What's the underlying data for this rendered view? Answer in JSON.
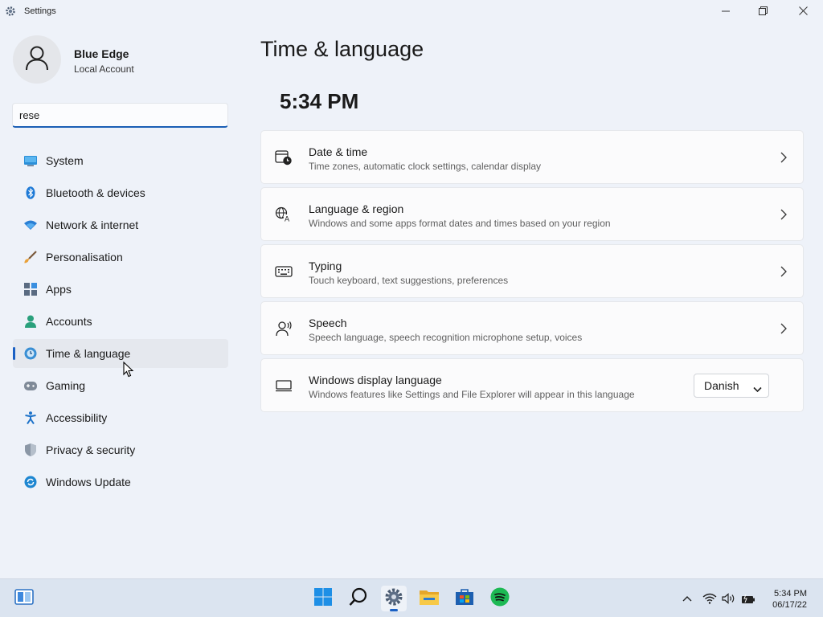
{
  "window": {
    "title": "Settings",
    "controls": {
      "minimize": "minimize-icon",
      "maximize": "restore-icon",
      "close": "close-icon"
    }
  },
  "profile": {
    "name": "Blue Edge",
    "account_type": "Local Account"
  },
  "search": {
    "value": "rese",
    "placeholder": ""
  },
  "sidebar": {
    "items": [
      {
        "label": "System",
        "icon": "system-icon",
        "active": false
      },
      {
        "label": "Bluetooth & devices",
        "icon": "bluetooth-icon",
        "active": false
      },
      {
        "label": "Network & internet",
        "icon": "wifi-icon",
        "active": false
      },
      {
        "label": "Personalisation",
        "icon": "brush-icon",
        "active": false
      },
      {
        "label": "Apps",
        "icon": "apps-icon",
        "active": false
      },
      {
        "label": "Accounts",
        "icon": "person-icon",
        "active": false
      },
      {
        "label": "Time & language",
        "icon": "globe-clock-icon",
        "active": true
      },
      {
        "label": "Gaming",
        "icon": "gamepad-icon",
        "active": false
      },
      {
        "label": "Accessibility",
        "icon": "accessibility-icon",
        "active": false
      },
      {
        "label": "Privacy & security",
        "icon": "shield-icon",
        "active": false
      },
      {
        "label": "Windows Update",
        "icon": "update-icon",
        "active": false
      }
    ]
  },
  "main": {
    "title": "Time & language",
    "clock": "5:34 PM",
    "cards": [
      {
        "title": "Date & time",
        "subtitle": "Time zones, automatic clock settings, calendar display",
        "icon": "calendar-clock-icon"
      },
      {
        "title": "Language & region",
        "subtitle": "Windows and some apps format dates and times based on your region",
        "icon": "language-icon"
      },
      {
        "title": "Typing",
        "subtitle": "Touch keyboard, text suggestions, preferences",
        "icon": "keyboard-icon"
      },
      {
        "title": "Speech",
        "subtitle": "Speech language, speech recognition microphone setup, voices",
        "icon": "speech-icon"
      },
      {
        "title": "Windows display language",
        "subtitle": "Windows features like Settings and File Explorer will appear in this language",
        "icon": "display-icon",
        "select_value": "Danish"
      }
    ]
  },
  "taskbar": {
    "apps": [
      "widgets-icon",
      "start-icon",
      "search-icon",
      "settings-icon",
      "file-explorer-icon",
      "store-icon",
      "spotify-icon"
    ],
    "time": "5:34 PM",
    "date": "06/17/22"
  },
  "colors": {
    "accent": "#1a60c4",
    "background": "#eef2f9",
    "card": "#fbfbfc",
    "taskbar": "#dbe4f0"
  }
}
